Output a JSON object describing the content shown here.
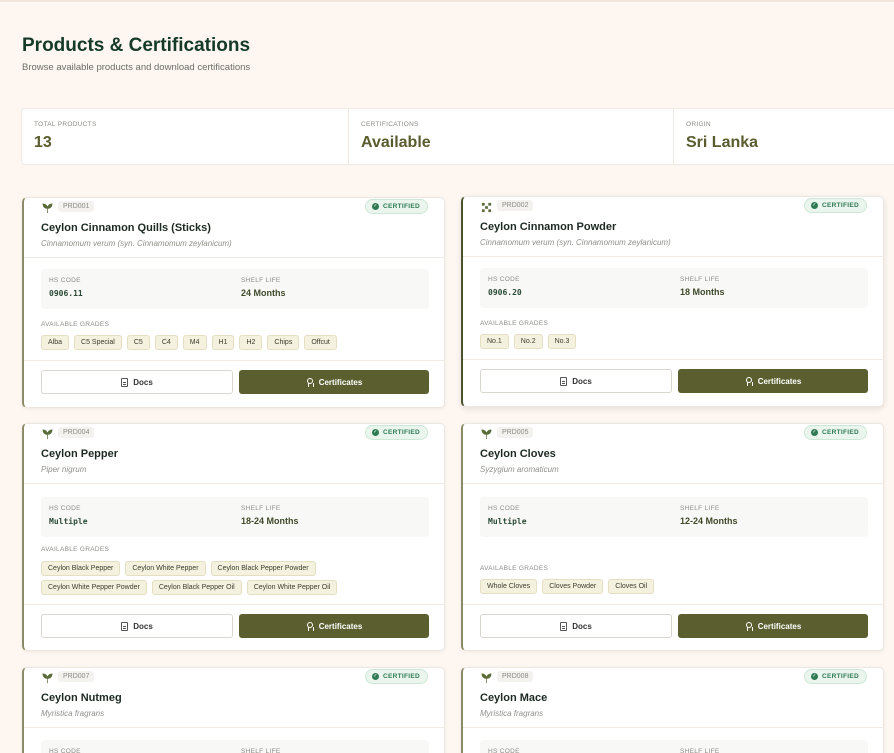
{
  "page": {
    "title": "Products & Certifications",
    "subtitle": "Browse available products and download certifications"
  },
  "stats": [
    {
      "label": "TOTAL PRODUCTS",
      "value": "13"
    },
    {
      "label": "CERTIFICATIONS",
      "value": "Available"
    },
    {
      "label": "ORIGIN",
      "value": "Sri Lanka"
    }
  ],
  "labels": {
    "hs_code": "HS CODE",
    "shelf_life": "SHELF LIFE",
    "available_grades": "AVAILABLE GRADES",
    "certified": "CERTIFIED",
    "docs": "Docs",
    "certificates": "Certificates"
  },
  "colors": {
    "background": "#fdf6f1",
    "accent": "#5b5f2f",
    "certified_green": "#2f7a55"
  },
  "products": [
    {
      "id": "PRD001",
      "icon": "leaf-icon",
      "name": "Ceylon Cinnamon Quills (Sticks)",
      "scientific": "Cinnamomum verum (syn. Cinnamomum zeylanicum)",
      "hs_code": "0906.11",
      "shelf_life": "24 Months",
      "grades": [
        "Alba",
        "C5 Special",
        "C5",
        "C4",
        "M4",
        "H1",
        "H2",
        "Chips",
        "Offcut"
      ]
    },
    {
      "id": "PRD002",
      "icon": "grid-icon",
      "name": "Ceylon Cinnamon Powder",
      "scientific": "Cinnamomum verum (syn. Cinnamomum zeylanicum)",
      "hs_code": "0906.20",
      "shelf_life": "18 Months",
      "grades": [
        "No.1",
        "No.2",
        "No.3"
      ]
    },
    {
      "id": "PRD004",
      "icon": "leaf-icon",
      "name": "Ceylon Pepper",
      "scientific": "Piper nigrum",
      "hs_code": "Multiple",
      "shelf_life": "18-24 Months",
      "grades": [
        "Ceylon Black Pepper",
        "Ceylon White Pepper",
        "Ceylon Black Pepper Powder",
        "Ceylon White Pepper Powder",
        "Ceylon Black Pepper Oil",
        "Ceylon White Pepper Oil"
      ]
    },
    {
      "id": "PRD005",
      "icon": "leaf-icon",
      "name": "Ceylon Cloves",
      "scientific": "Syzygium aromaticum",
      "hs_code": "Multiple",
      "shelf_life": "12-24 Months",
      "grades": [
        "Whole Cloves",
        "Cloves Powder",
        "Cloves Oil"
      ]
    },
    {
      "id": "PRD007",
      "icon": "leaf-icon",
      "name": "Ceylon Nutmeg",
      "scientific": "Myristica fragrans"
    },
    {
      "id": "PRD008",
      "icon": "leaf-icon",
      "name": "Ceylon Mace",
      "scientific": "Myristica fragrans"
    }
  ]
}
